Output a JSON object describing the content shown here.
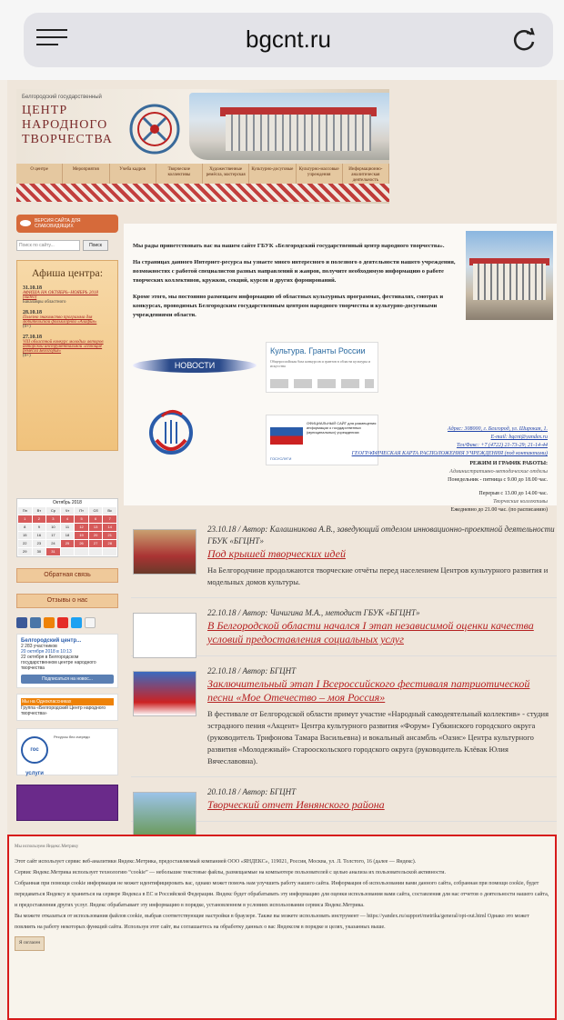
{
  "browser": {
    "url": "bgcnt.ru"
  },
  "header": {
    "small": "Белгородский государственный",
    "title_line1": "ЦЕНТР",
    "title_line2": "НАРОДНОГО",
    "title_line3": "ТВОРЧЕСТВА",
    "banner_sign": "ДОМ НАРОДНОГО ТВОРЧЕСТВА",
    "menu": [
      "О центре",
      "Мероприятия",
      "Учеба кадров",
      "Творческие коллективы",
      "Художественные ремёсла, мастерская",
      "Культурно-досуговые",
      "Культурно-массовые учреждения",
      "Информационно-аналитическая деятельность"
    ]
  },
  "sidebar": {
    "blind_version": "ВЕРСИЯ САЙТА ДЛЯ СЛАБОВИДЯЩИХ",
    "search_placeholder": "Поиск по сайту...",
    "search_button": "Поиск",
    "afisha_title": "Афиша центра:",
    "afisha_items": [
      {
        "date": "31.10.18",
        "link": "АФИША НА ОКТЯБРЬ–НОЯБРЬ 2018 (видео)",
        "sub": "Бакалавры областного"
      },
      {
        "date": "28.10.18",
        "link": "Полезно знакомство программа для любительской фольклорной «Алафия»",
        "sub": "(0+)"
      },
      {
        "date": "27.10.18",
        "link": "VIII областной конкурс молодых авторов авторской инструментальной «Поющие ремёсла Белогорья»",
        "sub": "(0+)"
      }
    ],
    "calendar_title": "Октябрь 2018",
    "calendar_days": [
      "Пн",
      "Вт",
      "Ср",
      "Чт",
      "Пт",
      "Сб",
      "Вс"
    ],
    "feedback": "Обратная связь",
    "reviews": "Отзывы о нас",
    "vk_title": "Белгородский центр...",
    "vk_members": "2 283 участников",
    "vk_date": "20 октября 2018 в 10:13",
    "vk_text": "22 октября в Белгородском государственном центре народного творчества",
    "vk_subscribe": "Подписаться на новос...",
    "ok_title": "Мы на Одноклассниках",
    "ok_group": "Группа «Белгородский Центр народного творчества»",
    "gos_logo": "гос услуги",
    "gos_title": "Ресурсы без очереди"
  },
  "welcome": {
    "p1": "Мы рады приветствовать вас на нашем сайте ГБУК «Белгородский государственный центр народного творчества».",
    "p2": "На страницах данного Интернет-ресурса вы узнаете много интересного и полезного о деятельности нашего учреждения, возможностях с работой специалистов разных направлений и жанров, получите необходимую информацию о работе творческих коллективов, кружков, секций, курсов и других формирований.",
    "p3": "Кроме этого, мы постоянно размещаем информацию об областных культурных программах, фестивалях, смотрах и конкурсах, проводимых Белгородским государственным центром народного творчества и культурно-досуговыми учреждениями области.",
    "news_button": "НОВОСТИ",
    "grants_title": "Культура. Гранты России",
    "grants_sub": "Общероссийская база конкурсов и грантов в области культуры и искусства",
    "official_title": "ОФИЦИАЛЬНЫЙ САЙТ для размещения информации о государственных (муниципальных) учреждениях",
    "official_bottom": "ГОСУСЛУГИ",
    "address": "Адрес: 308000, г. Белгород, ул. Широкая, 1.",
    "email": "E-mail: bgcnt@yandex.ru",
    "phone": "Тел/Факс: +7 (4722) 21-73-29; 21-14-44",
    "map_link": "ГЕОГРАФИЧЕСКАЯ КАРТА РАСПОЛОЖЕНИЯ УЧРЕЖДЕНИЯ (под контактами)",
    "schedule_title": "РЕЖИМ И ГРАФИК РАБОТЫ:",
    "sched1": "Административно-методические отделы",
    "sched2": "Понедельник - пятница с 9.00 до 18.00 час.",
    "sched3": "Перерыв с 13.00 до 14.00 час.",
    "sched4": "Творческие коллективы",
    "sched5": "Ежедневно до 21.00 час. (по расписанию)"
  },
  "news": [
    {
      "meta": "23.10.18  /  Автор: Калашникова А.В., заведующий отделом инновационно-проектной деятельности ГБУК «БГЦНТ»",
      "title": "Под крышей творческих идей",
      "body": "На Белгородчине продолжаются творческие отчёты перед населением Центров культурного развития и модельных домов культуры."
    },
    {
      "meta": "22.10.18  /  Автор: Чичигина М.А., методист ГБУК «БГЦНТ»",
      "title": "В Белгородской области начался I этап независимой оценки качества условий предоставления социальных услуг",
      "body": ""
    },
    {
      "meta": "22.10.18  /  Автор: БГЦНТ",
      "title": "Заключительный этап I Всероссийского фестиваля патриотической песни «Мое Отечество – моя Россия»",
      "body": "В фестивале от Белгородской области примут участие «Народный самодеятельный коллектив» - студия эстрадного пения «Акцент» Центра культурного развития «Форум» Губкинского городского округа (руководитель Трифонова Тамара Васильевна) и вокальный ансамбль «Оазис» Центра культурного развития «Молодежный» Старооскольского городского округа (руководитель Клёвак Юлия Вячеславовна)."
    },
    {
      "meta": "20.10.18  /  Автор: БГЦНТ",
      "title": "Творческий отчет Ивнянского района",
      "body": ""
    }
  ],
  "cookie": {
    "head": "Мы используем Яндекс.Метрику",
    "p1": "Этот сайт использует сервис веб-аналитики Яндекс.Метрика, предоставляемый компанией ООО «ЯНДЕКС», 119021, Россия, Москва, ул. Л. Толстого, 16 (далее — Яндекс).",
    "p2": "Сервис Яндекс.Метрика использует технологию “cookie” — небольшие текстовые файлы, размещаемые на компьютере пользователей с целью анализа их пользовательской активности.",
    "p3": "Собранная при помощи cookie информация не может идентифицировать вас, однако может помочь нам улучшить работу нашего сайта. Информация об использовании вами данного сайта, собранная при помощи cookie, будет передаваться Яндексу и храниться на сервере Яндекса в ЕС и Российской Федерации. Яндекс будет обрабатывать эту информацию для оценки использования вами сайта, составления для нас отчетов о деятельности нашего сайта, и предоставления других услуг. Яндекс обрабатывает эту информацию в порядке, установленном в условиях использования сервиса Яндекс.Метрика.",
    "p4": "Вы можете отказаться от использования файлов cookie, выбрав соответствующие настройки в браузере. Также вы можете использовать инструмент — https://yandex.ru/support/metrika/general/opt-out.html Однако это может повлиять на работу некоторых функций сайта. Используя этот сайт, вы соглашаетесь на обработку данных о вас Яндексом в порядке и целях, указанных выше.",
    "more": "Я согласен"
  }
}
